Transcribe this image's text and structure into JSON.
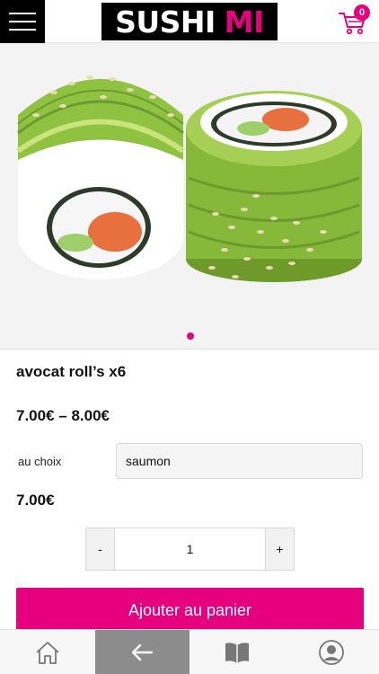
{
  "header": {
    "logo_main": "SUSHI",
    "logo_accent": "MI",
    "cart_count": "0",
    "icons": [
      "hamburger-menu-icon",
      "cart-icon"
    ]
  },
  "gallery": {
    "image": "sushi-avocado-roll-image",
    "active_slide": 1,
    "slide_count": 1
  },
  "product": {
    "title": "avocat roll’s x6",
    "price_range": "7.00€ – 8.00€",
    "choice_label": "au choix",
    "choice_value": "saumon",
    "price": "7.00€"
  },
  "quantity": {
    "minus_label": "-",
    "value": "1",
    "plus_label": "+"
  },
  "add_to_cart": {
    "label": "Ajouter au panier"
  },
  "bottom_nav": {
    "items": [
      {
        "icon": "home-icon"
      },
      {
        "icon": "back-arrow-icon",
        "active": true
      },
      {
        "icon": "book-icon"
      },
      {
        "icon": "user-icon"
      }
    ]
  },
  "colors": {
    "accent": "#e6007e",
    "header_black": "#000000",
    "nav_active": "#8c8c8c"
  }
}
